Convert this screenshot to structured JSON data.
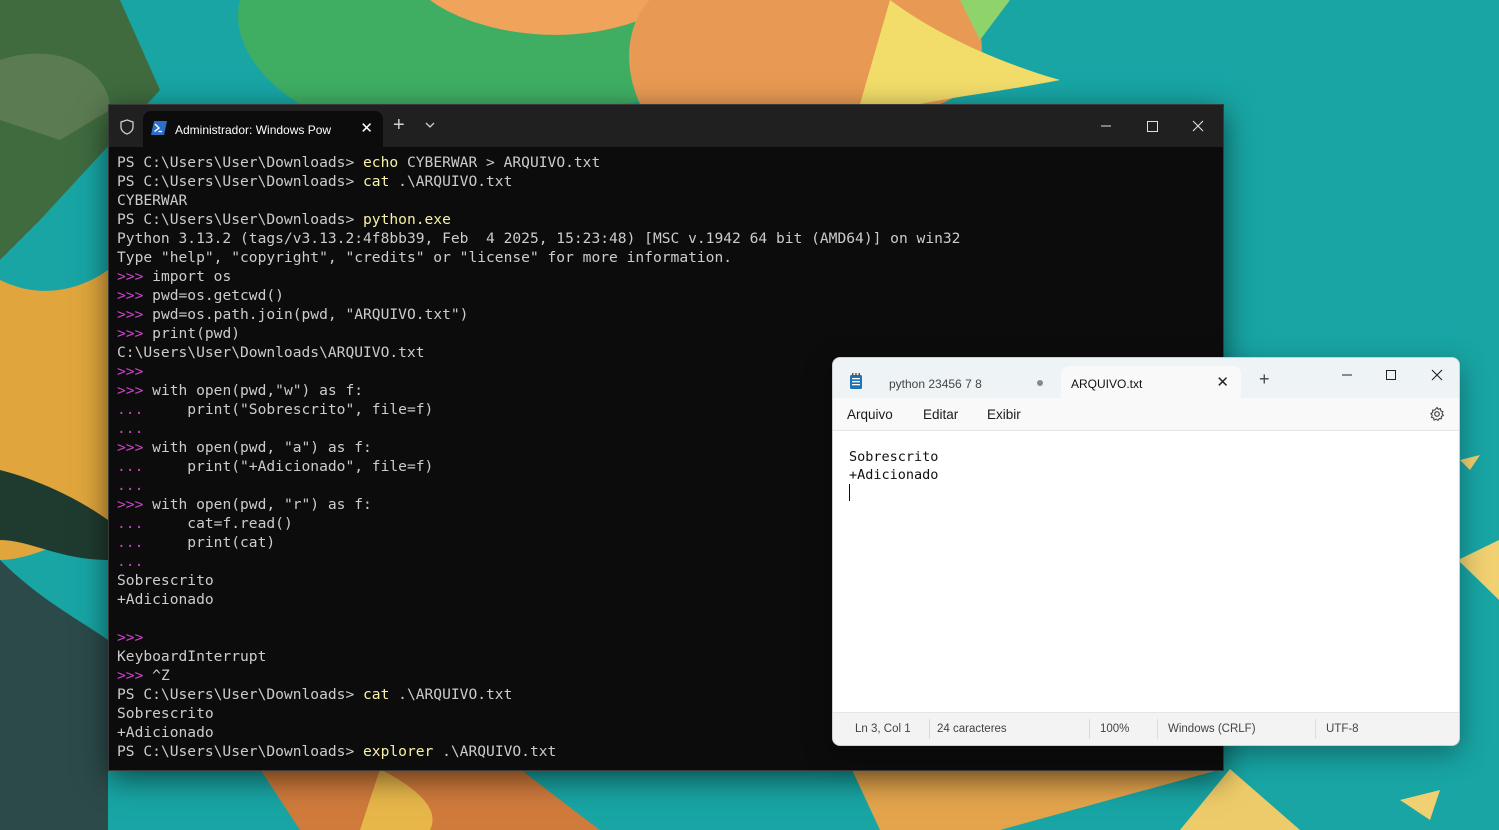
{
  "terminal": {
    "tab_title": "Administrador: Windows Pow",
    "new_tab_label": "+",
    "lines": [
      {
        "segments": [
          {
            "t": "PS C:\\Users\\User\\Downloads> ",
            "c": "prompt"
          },
          {
            "t": "echo",
            "c": "cmd"
          },
          {
            "t": " CYBERWAR > ARQUIVO.txt",
            "c": "prompt"
          }
        ]
      },
      {
        "segments": [
          {
            "t": "PS C:\\Users\\User\\Downloads> ",
            "c": "prompt"
          },
          {
            "t": "cat",
            "c": "cmd"
          },
          {
            "t": " .\\ARQUIVO.txt",
            "c": "prompt"
          }
        ]
      },
      {
        "segments": [
          {
            "t": "CYBERWAR",
            "c": "prompt"
          }
        ]
      },
      {
        "segments": [
          {
            "t": "PS C:\\Users\\User\\Downloads> ",
            "c": "prompt"
          },
          {
            "t": "python.exe",
            "c": "cmd"
          }
        ]
      },
      {
        "segments": [
          {
            "t": "Python 3.13.2 (tags/v3.13.2:4f8bb39, Feb  4 2025, 15:23:48) [MSC v.1942 64 bit (AMD64)] on win32",
            "c": "prompt"
          }
        ]
      },
      {
        "segments": [
          {
            "t": "Type \"help\", \"copyright\", \"credits\" or \"license\" for more information.",
            "c": "prompt"
          }
        ]
      },
      {
        "segments": [
          {
            "t": ">>> ",
            "c": "py"
          },
          {
            "t": "import os",
            "c": "prompt"
          }
        ]
      },
      {
        "segments": [
          {
            "t": ">>> ",
            "c": "py"
          },
          {
            "t": "pwd=os.getcwd()",
            "c": "prompt"
          }
        ]
      },
      {
        "segments": [
          {
            "t": ">>> ",
            "c": "py"
          },
          {
            "t": "pwd=os.path.join(pwd, \"ARQUIVO.txt\")",
            "c": "prompt"
          }
        ]
      },
      {
        "segments": [
          {
            "t": ">>> ",
            "c": "py"
          },
          {
            "t": "print(pwd)",
            "c": "prompt"
          }
        ]
      },
      {
        "segments": [
          {
            "t": "C:\\Users\\User\\Downloads\\ARQUIVO.txt",
            "c": "prompt"
          }
        ]
      },
      {
        "segments": [
          {
            "t": ">>>",
            "c": "py"
          }
        ]
      },
      {
        "segments": [
          {
            "t": ">>> ",
            "c": "py"
          },
          {
            "t": "with open(pwd,\"w\") as f:",
            "c": "prompt"
          }
        ]
      },
      {
        "segments": [
          {
            "t": "...     ",
            "c": "py"
          },
          {
            "t": "print(\"Sobrescrito\", file=f)",
            "c": "prompt"
          }
        ]
      },
      {
        "segments": [
          {
            "t": "...",
            "c": "py"
          }
        ]
      },
      {
        "segments": [
          {
            "t": ">>> ",
            "c": "py"
          },
          {
            "t": "with open(pwd, \"a\") as f:",
            "c": "prompt"
          }
        ]
      },
      {
        "segments": [
          {
            "t": "...     ",
            "c": "py"
          },
          {
            "t": "print(\"+Adicionado\", file=f)",
            "c": "prompt"
          }
        ]
      },
      {
        "segments": [
          {
            "t": "...",
            "c": "py"
          }
        ]
      },
      {
        "segments": [
          {
            "t": ">>> ",
            "c": "py"
          },
          {
            "t": "with open(pwd, \"r\") as f:",
            "c": "prompt"
          }
        ]
      },
      {
        "segments": [
          {
            "t": "...     ",
            "c": "py"
          },
          {
            "t": "cat=f.read()",
            "c": "prompt"
          }
        ]
      },
      {
        "segments": [
          {
            "t": "...     ",
            "c": "py"
          },
          {
            "t": "print(cat)",
            "c": "prompt"
          }
        ]
      },
      {
        "segments": [
          {
            "t": "...",
            "c": "py"
          }
        ]
      },
      {
        "segments": [
          {
            "t": "Sobrescrito",
            "c": "prompt"
          }
        ]
      },
      {
        "segments": [
          {
            "t": "+Adicionado",
            "c": "prompt"
          }
        ]
      },
      {
        "segments": [
          {
            "t": "",
            "c": "prompt"
          }
        ]
      },
      {
        "segments": [
          {
            "t": ">>>",
            "c": "py"
          }
        ]
      },
      {
        "segments": [
          {
            "t": "KeyboardInterrupt",
            "c": "prompt"
          }
        ]
      },
      {
        "segments": [
          {
            "t": ">>> ",
            "c": "py"
          },
          {
            "t": "^Z",
            "c": "prompt"
          }
        ]
      },
      {
        "segments": [
          {
            "t": "PS C:\\Users\\User\\Downloads> ",
            "c": "prompt"
          },
          {
            "t": "cat",
            "c": "cmd"
          },
          {
            "t": " .\\ARQUIVO.txt",
            "c": "prompt"
          }
        ]
      },
      {
        "segments": [
          {
            "t": "Sobrescrito",
            "c": "prompt"
          }
        ]
      },
      {
        "segments": [
          {
            "t": "+Adicionado",
            "c": "prompt"
          }
        ]
      },
      {
        "segments": [
          {
            "t": "PS C:\\Users\\User\\Downloads> ",
            "c": "prompt"
          },
          {
            "t": "explorer",
            "c": "cmd"
          },
          {
            "t": " .\\ARQUIVO.txt",
            "c": "prompt"
          }
        ]
      }
    ],
    "colors": {
      "background": "#0c0c0c",
      "text": "#cccccc",
      "command": "#f9f1a5",
      "python_prompt": "#cc44cc"
    }
  },
  "notepad": {
    "tab1_title": "python 23456 7 8",
    "tab2_title": "ARQUIVO.txt",
    "new_tab_label": "+",
    "menu": {
      "file": "Arquivo",
      "edit": "Editar",
      "view": "Exibir"
    },
    "content": "Sobrescrito\n+Adicionado\n",
    "status": {
      "position": "Ln 3, Col 1",
      "chars": "24 caracteres",
      "zoom": "100%",
      "line_ending": "Windows (CRLF)",
      "encoding": "UTF-8"
    }
  }
}
